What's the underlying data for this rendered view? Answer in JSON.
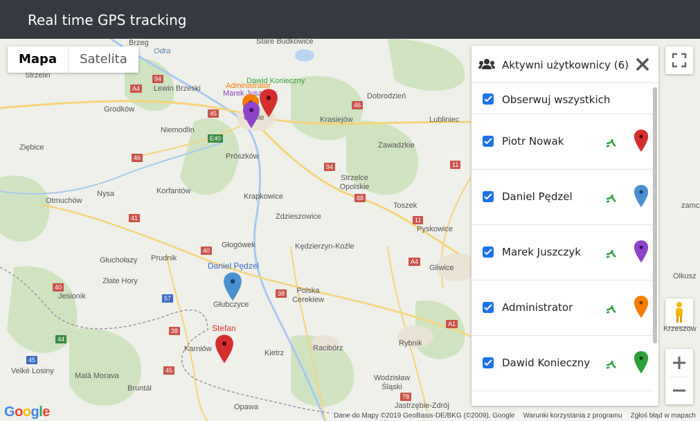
{
  "header": {
    "title": "Real time GPS tracking"
  },
  "map_type": {
    "map_label": "Mapa",
    "satellite_label": "Satelita"
  },
  "panel": {
    "title": "Aktywni użytkownicy (6)",
    "observe_all_label": "Obserwuj wszystkich",
    "users": [
      {
        "name": "Piotr Nowak",
        "pin_color": "#d32f2f",
        "checked": true
      },
      {
        "name": "Daniel Pędzel",
        "pin_color": "#4a90d0",
        "checked": true
      },
      {
        "name": "Marek Juszczyk",
        "pin_color": "#8e44c8",
        "checked": true
      },
      {
        "name": "Administrator",
        "pin_color": "#f57c00",
        "checked": true
      },
      {
        "name": "Dawid Konieczny",
        "pin_color": "#2e9e3a",
        "checked": true
      }
    ]
  },
  "markers": [
    {
      "label": "Daniel Pędzel",
      "color": "#4a90d0"
    },
    {
      "label": "Stefan",
      "color": "#d32f2f"
    }
  ],
  "opole_cluster_labels": [
    "Dawid Konieczny",
    "Administrator",
    "Marek Juszczyk"
  ],
  "map_labels": [
    "Brzeg",
    "Odra",
    "Stare Budkowice",
    "Strzelin",
    "Lewin Brzeski",
    "Dobrodzień",
    "Grodków",
    "Opole",
    "Niemodlin",
    "Krasiejów",
    "Lubliniec",
    "Ziębice",
    "Zawadzkie",
    "Prószków",
    "Strzelce Opolskie",
    "Nysa",
    "Korfantów",
    "Otmuchów",
    "Krapkowice",
    "Toszek",
    "Zdzieszowice",
    "Pyskowice",
    "Głogówek",
    "Kędzierzyn-Koźle",
    "Prudnik",
    "Głuchołazy",
    "Gliwice",
    "Olkusz",
    "Złate Hory",
    "Głubczyce",
    "Polska Cerekiew",
    "Jesionik",
    "Karniów",
    "Kietrz",
    "Racibórz",
    "Rybnik",
    "Krzeszow",
    "Bruntál",
    "Malá Morava",
    "Velké Losiny",
    "Wodzisław Śląski",
    "Jastrzębie-Zdrój",
    "Opawa",
    "zamcze"
  ],
  "attribution": {
    "data": "Dane do Mapy ©2019 GeoBasis-DE/BKG (©2009), Google",
    "terms": "Warunki korzystania z programu",
    "report": "Zgłoś błąd w mapach"
  },
  "google_logo": "Google",
  "colors": {
    "header_bg": "#343a40",
    "checkbox": "#1a73e8",
    "signal": "#2e9e3a"
  }
}
